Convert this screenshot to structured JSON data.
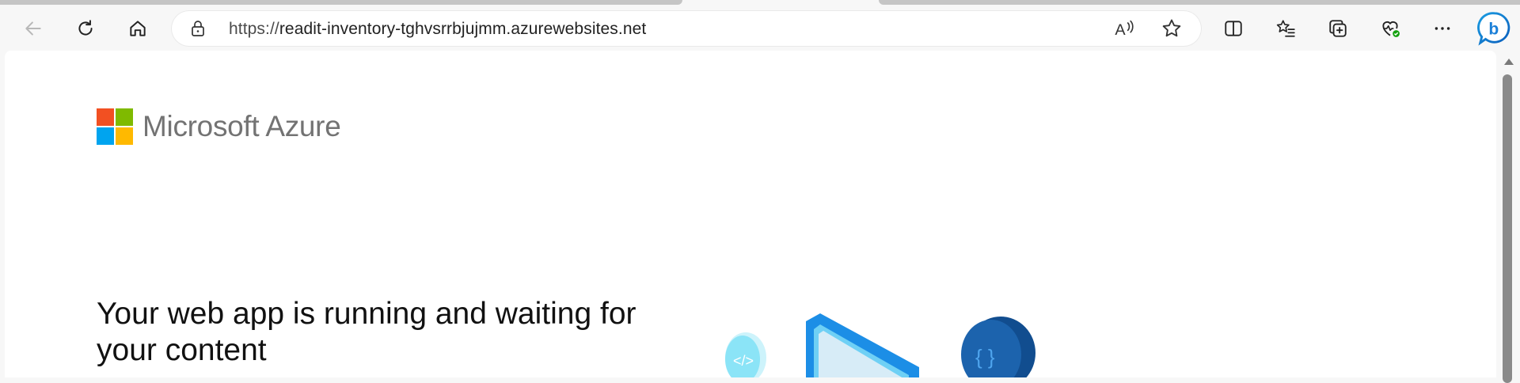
{
  "browser": {
    "url_prefix": "https://",
    "url_host": "readit-inventory-tghvsrrbjujmm.azurewebsites.net",
    "icons": {
      "back": "back-arrow-icon",
      "refresh": "refresh-icon",
      "home": "home-icon",
      "site_info": "lock-icon",
      "read_aloud": "read-aloud-icon",
      "favorite": "star-icon",
      "split_screen": "split-screen-icon",
      "favorites": "favorites-icon",
      "collections": "collections-icon",
      "health": "browser-essentials-icon",
      "menu": "more-icon",
      "copilot": "bing-icon"
    }
  },
  "page": {
    "brand": "Microsoft Azure",
    "headline": "Your web app is running and waiting for your content",
    "logo_colors": [
      "#f25022",
      "#7fba00",
      "#00a4ef",
      "#ffb900"
    ]
  }
}
